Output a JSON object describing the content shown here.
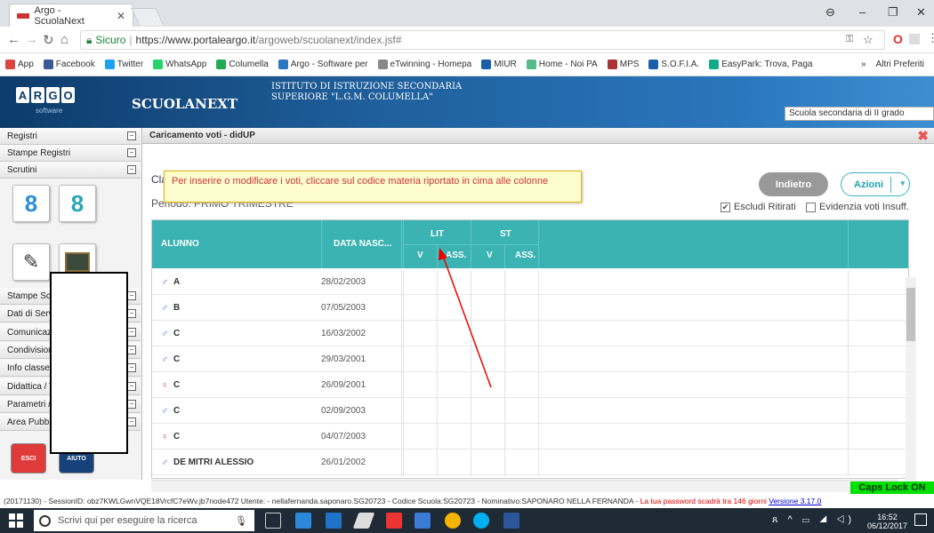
{
  "browser": {
    "tab_title": "Argo - ScuolaNext",
    "url_secure": "Sicuro",
    "url_domain": "https://www.portaleargo.it",
    "url_path": "/argoweb/scuolanext/index.jsf#",
    "bookmarks": [
      {
        "label": "App",
        "color": "#d44"
      },
      {
        "label": "Facebook",
        "color": "#3b5998"
      },
      {
        "label": "Twitter",
        "color": "#1da1f2"
      },
      {
        "label": "WhatsApp",
        "color": "#25d366"
      },
      {
        "label": "Columella",
        "color": "#2a5"
      },
      {
        "label": "Argo - Software per",
        "color": "#2a77bd"
      },
      {
        "label": "eTwinning - Homepa",
        "color": "#888"
      },
      {
        "label": "MIUR",
        "color": "#1b5faa"
      },
      {
        "label": "Home - Noi PA",
        "color": "#5b8"
      },
      {
        "label": "MPS",
        "color": "#a33"
      },
      {
        "label": "S.O.F.I.A.",
        "color": "#1b5faa"
      },
      {
        "label": "EasyPark: Trova, Paga",
        "color": "#1a8"
      }
    ],
    "bookmarks_more": "»",
    "other_bookmarks": "Altri Preferiti"
  },
  "header": {
    "logo_letters": [
      "A",
      "R",
      "G",
      "O"
    ],
    "logo_sub": "software",
    "app_name": "SCUOLANEXT",
    "school_line1": "ISTITUTO DI ISTRUZIONE SECONDARIA",
    "school_line2": "SUPERIORE \"L.G.M. COLUMELLA\"",
    "school_type": "Scuola secondaria di II grado"
  },
  "sidebar": {
    "top_items": [
      {
        "label": "Registri",
        "toggle": "−"
      },
      {
        "label": "Stampe Registri",
        "toggle": "−"
      },
      {
        "label": "Scrutini",
        "toggle": "−"
      }
    ],
    "items": [
      {
        "label": "Stampe Scrutini",
        "toggle": "−"
      },
      {
        "label": "Dati di Servizio e Contabili",
        "toggle": "−"
      },
      {
        "label": "Comunicazioni",
        "toggle": "−"
      },
      {
        "label": "Condivisione Documenti",
        "toggle": "−"
      },
      {
        "label": "Info classe / docenti",
        "toggle": "−"
      },
      {
        "label": "Didattica / Tabelle",
        "toggle": "−"
      },
      {
        "label": "Parametri / Utility",
        "toggle": "−"
      },
      {
        "label": "Area Pubblica",
        "toggle": "−"
      }
    ],
    "exit_label": "ESCI",
    "help_label": "AIUTO"
  },
  "main": {
    "title": "Caricamento voti - didUP",
    "tooltip": "Per inserire o modificare i voti, cliccare sul codice materia riportato in cima alle colonne",
    "classe_prefix": "Cla",
    "periodo": "Periodo: PRIMO TRIMESTRE",
    "back_button": "Indietro",
    "actions_button": "Azioni",
    "exclude_withdrawn": "Escludi Ritirati",
    "highlight_insufficient": "Evidenzia voti Insuff.",
    "columns": {
      "student": "ALUNNO",
      "birth": "DATA NASC...",
      "subject1": "LIT",
      "subject2": "ST",
      "v": "V",
      "ass": "ASS."
    },
    "rows": [
      {
        "gender": "♂",
        "initial": "A",
        "date": "28/02/2003"
      },
      {
        "gender": "♂",
        "initial": "B",
        "date": "07/05/2003"
      },
      {
        "gender": "♂",
        "initial": "C",
        "date": "16/03/2002"
      },
      {
        "gender": "♂",
        "initial": "C",
        "date": "29/03/2001"
      },
      {
        "gender": "♀",
        "initial": "C",
        "date": "26/09/2001"
      },
      {
        "gender": "♂",
        "initial": "C",
        "date": "02/09/2003"
      },
      {
        "gender": "♀",
        "initial": "C",
        "date": "04/07/2003"
      },
      {
        "gender": "♂",
        "initial": "DE MITRI ALESSIO",
        "date": "26/01/2002"
      }
    ],
    "colors": {
      "header": "#3cb3b3",
      "male": "#4a7fd0",
      "female": "#d0477f"
    }
  },
  "status": {
    "caps": "Caps Lock ON",
    "session": "(20171130) - SessionID: obz7KWLGwnVQE18VrcfC7eWv.jb7node472 Utente: - nellafernanda.saponaro.SG20723 - Codice Scuola:SG20723 - Nominativo:SAPONARO NELLA FERNANDA",
    "password_warning": "- La tua password scadrà tra 146 giorni",
    "version": "Versione 3.17.0"
  },
  "taskbar": {
    "search_placeholder": "Scrivi qui per eseguire la ricerca",
    "time": "16:52",
    "date": "06/12/2017"
  }
}
